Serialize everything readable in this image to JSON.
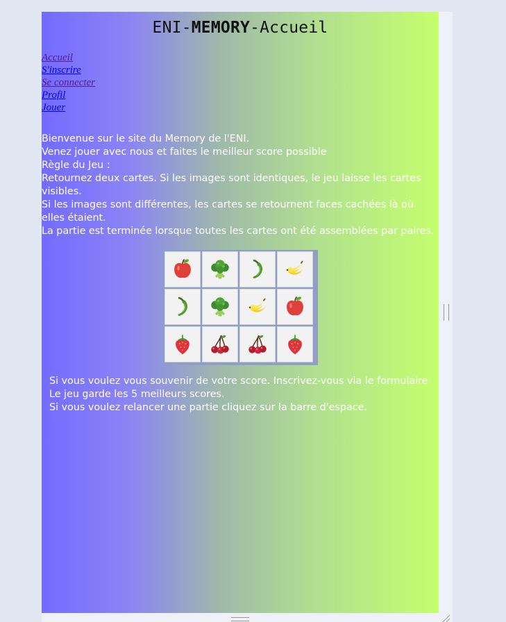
{
  "header": {
    "title_prefix": "ENI-",
    "title_bold": "MEMORY",
    "title_suffix": "-Accueil"
  },
  "nav": {
    "items": [
      {
        "label": "Accueil",
        "state": "visited"
      },
      {
        "label": "S'inscrire",
        "state": "link"
      },
      {
        "label": "Se connecter",
        "state": "visited"
      },
      {
        "label": "Profil",
        "state": "link"
      },
      {
        "label": "Jouer",
        "state": "link"
      }
    ]
  },
  "intro": {
    "welcome": "Bienvenue sur le site du Memory de l'ENI.",
    "invite": "Venez jouer avec nous et faites le meilleur score possible",
    "rules_title": "Règle du Jeu :",
    "rule_1": "Retournez deux cartes. Si les images sont identiques, le jeu laisse les cartes visibles.",
    "rule_2": "Si les images sont différentes, les cartes se retournent faces cachées là où elles étaient.",
    "rule_3": "La partie est terminée lorsque toutes les cartes ont été assemblées par paires."
  },
  "board": {
    "cards": [
      [
        "apple-icon",
        "broccoli-icon",
        "chili-pepper-icon",
        "banana-icon"
      ],
      [
        "chili-pepper-icon",
        "broccoli-icon",
        "banana-icon",
        "apple-icon"
      ],
      [
        "strawberry-icon",
        "cherries-icon",
        "cherries-icon",
        "strawberry-icon"
      ]
    ]
  },
  "outro": {
    "line_1": "Si vous voulez vous souvenir de votre score. Inscrivez-vous via le formulaire.",
    "line_2": "Le jeu garde les 5 meilleurs scores.",
    "line_3": "Si vous voulez relancer une partie cliquez sur la barre d'espace."
  },
  "colors": {
    "gradient_start": "#746bff",
    "gradient_end": "#c4ff6d",
    "link": "#0000ee",
    "visited_link": "#551a8b",
    "text": "#ffffff"
  }
}
